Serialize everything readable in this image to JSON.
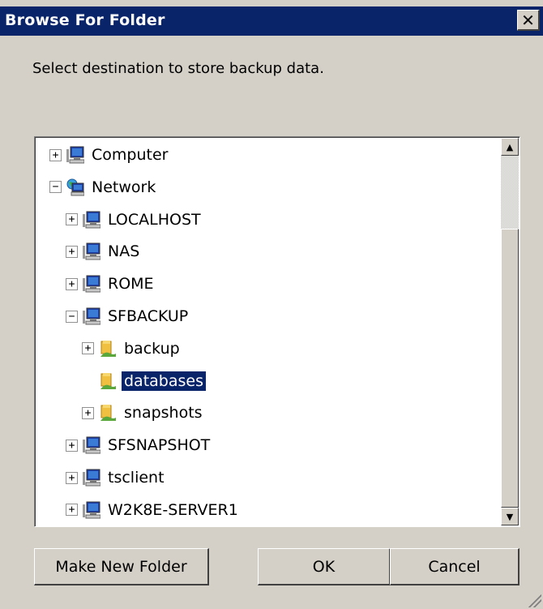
{
  "window": {
    "title": "Browse For Folder",
    "close_glyph": "✕"
  },
  "instruction": "Select destination to store backup data.",
  "tree": {
    "items": [
      {
        "label": "Computer",
        "icon": "computer-icon",
        "expander": "+",
        "level": 0,
        "selected": false
      },
      {
        "label": "Network",
        "icon": "network-icon",
        "expander": "−",
        "level": 0,
        "selected": false
      },
      {
        "label": "LOCALHOST",
        "icon": "computer-icon",
        "expander": "+",
        "level": 1,
        "selected": false
      },
      {
        "label": "NAS",
        "icon": "computer-icon",
        "expander": "+",
        "level": 1,
        "selected": false
      },
      {
        "label": "ROME",
        "icon": "computer-icon",
        "expander": "+",
        "level": 1,
        "selected": false
      },
      {
        "label": "SFBACKUP",
        "icon": "computer-icon",
        "expander": "−",
        "level": 1,
        "selected": false
      },
      {
        "label": "backup",
        "icon": "shared-folder-icon",
        "expander": "+",
        "level": 2,
        "selected": false
      },
      {
        "label": "databases",
        "icon": "shared-folder-icon",
        "expander": "",
        "level": 2,
        "selected": true
      },
      {
        "label": "snapshots",
        "icon": "shared-folder-icon",
        "expander": "+",
        "level": 2,
        "selected": false
      },
      {
        "label": "SFSNAPSHOT",
        "icon": "computer-icon",
        "expander": "+",
        "level": 1,
        "selected": false
      },
      {
        "label": "tsclient",
        "icon": "computer-icon",
        "expander": "+",
        "level": 1,
        "selected": false
      },
      {
        "label": "W2K8E-SERVER1",
        "icon": "computer-icon",
        "expander": "+",
        "level": 1,
        "selected": false
      }
    ]
  },
  "scrollbar": {
    "up_glyph": "▲",
    "down_glyph": "▼"
  },
  "buttons": {
    "make_new_folder": "Make New Folder",
    "ok": "OK",
    "cancel": "Cancel"
  },
  "colors": {
    "title_bar": "#0a246a",
    "selection": "#0a246a",
    "dialog_bg": "#d4d0c8"
  }
}
